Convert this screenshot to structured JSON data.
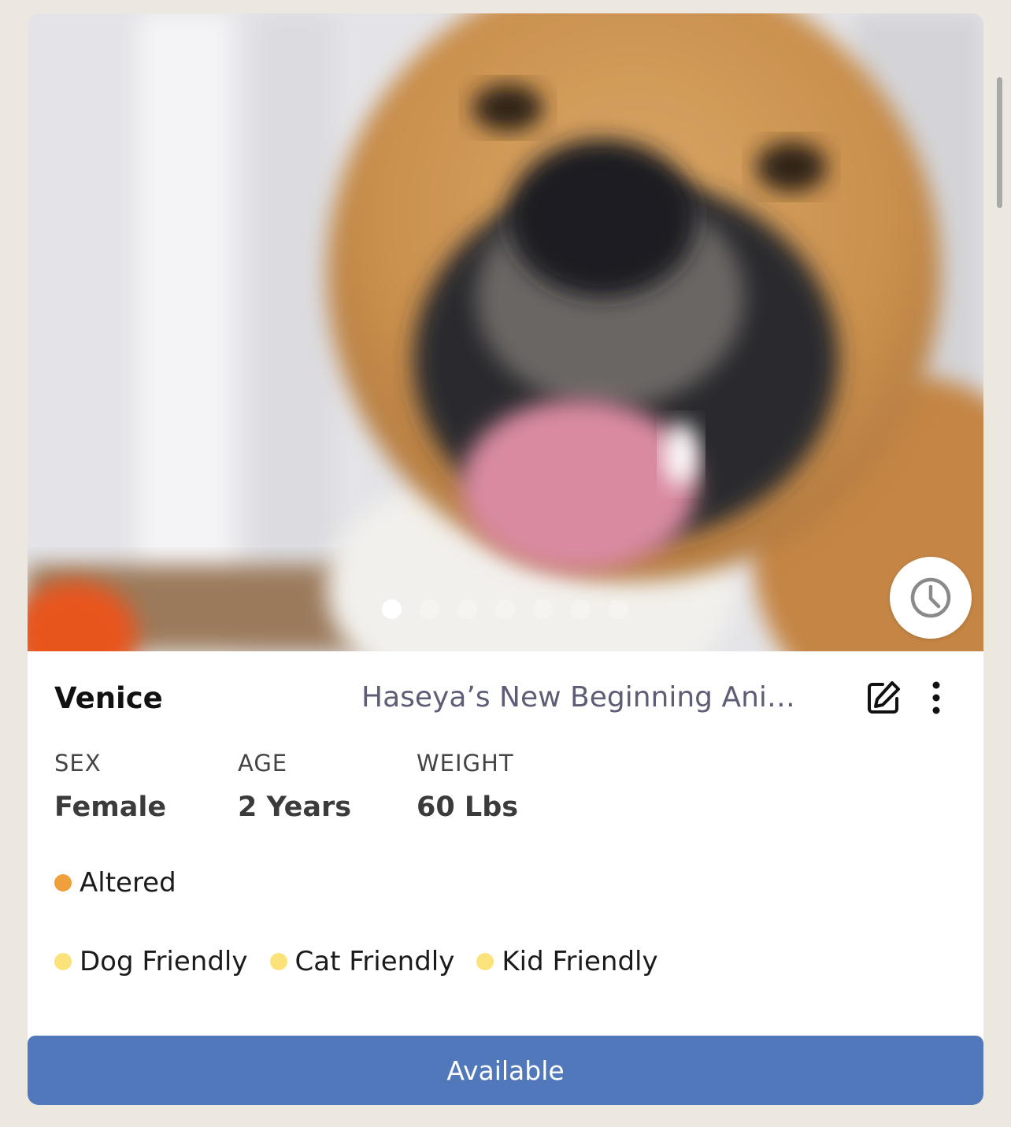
{
  "pet": {
    "name": "Venice",
    "organization": "Haseya’s New Beginning Animal Rescue",
    "stats": [
      {
        "label": "SEX",
        "value": "Female"
      },
      {
        "label": "AGE",
        "value": "2 Years"
      },
      {
        "label": "WEIGHT",
        "value": "60 Lbs"
      }
    ],
    "medical_tags": [
      {
        "label": "Altered",
        "color": "#f0a03a"
      }
    ],
    "behavior_tags": [
      {
        "label": "Dog Friendly",
        "color": "#fbe27a"
      },
      {
        "label": "Cat Friendly",
        "color": "#fbe27a"
      },
      {
        "label": "Kid Friendly",
        "color": "#fbe27a"
      }
    ]
  },
  "gallery": {
    "photo_count": 7,
    "active_index": 0,
    "history_icon": "clock-icon"
  },
  "actions": {
    "edit_icon": "edit-icon",
    "more_icon": "more-vertical-icon"
  },
  "status": {
    "label": "Available",
    "color": "#5078ba"
  }
}
